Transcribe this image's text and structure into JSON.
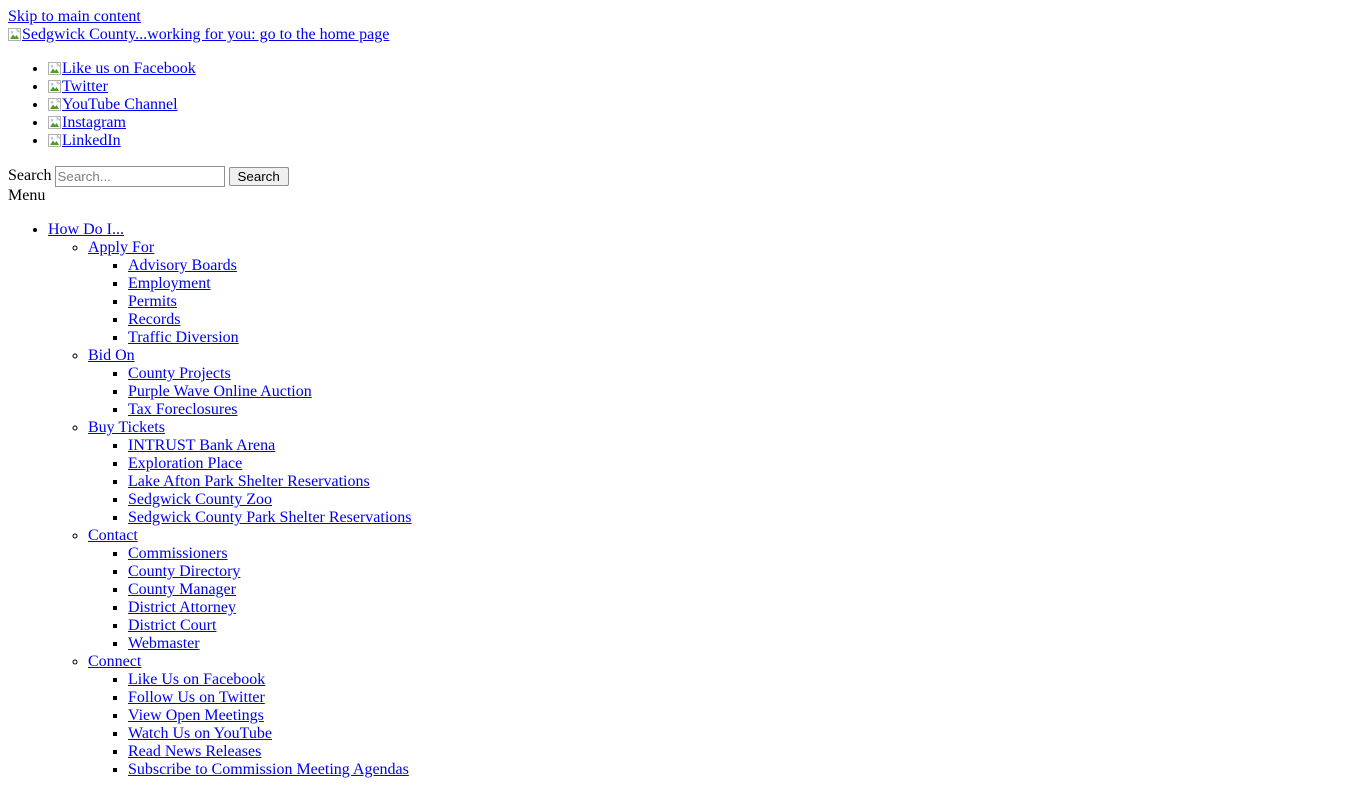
{
  "page": {
    "skip_link": "Skip to main content",
    "logo_link": "Sedgwick County...working for you: go to the home page",
    "menu_label": "Menu"
  },
  "social": {
    "items": [
      {
        "label": "Like us on Facebook",
        "icon": "broken-image-icon"
      },
      {
        "label": "Twitter",
        "icon": "broken-image-icon"
      },
      {
        "label": "YouTube Channel",
        "icon": "broken-image-icon"
      },
      {
        "label": "Instagram",
        "icon": "broken-image-icon"
      },
      {
        "label": "LinkedIn",
        "icon": "broken-image-icon"
      }
    ]
  },
  "search": {
    "label": "Search",
    "placeholder": "Search...",
    "value": "",
    "button_label": "Search"
  },
  "menu": {
    "items": [
      {
        "label": "How Do I...",
        "groups": [
          {
            "label": "Apply For",
            "links": [
              "Advisory Boards",
              "Employment",
              "Permits",
              "Records",
              "Traffic Diversion"
            ]
          },
          {
            "label": "Bid On",
            "links": [
              "County Projects",
              "Purple Wave Online Auction",
              "Tax Foreclosures"
            ]
          },
          {
            "label": "Buy Tickets",
            "links": [
              "INTRUST Bank Arena",
              "Exploration Place",
              "Lake Afton Park Shelter Reservations",
              "Sedgwick County Zoo",
              "Sedgwick County Park Shelter Reservations"
            ]
          },
          {
            "label": "Contact",
            "links": [
              "Commissioners",
              "County Directory",
              "County Manager",
              "District Attorney",
              "District Court",
              "Webmaster"
            ]
          },
          {
            "label": "Connect",
            "links": [
              "Like Us on Facebook",
              "Follow Us on Twitter",
              "View Open Meetings",
              "Watch Us on YouTube",
              "Read News Releases",
              "Subscribe to Commission Meeting Agendas"
            ]
          }
        ]
      }
    ]
  },
  "colors": {
    "link": "#0000EE",
    "text": "#000000",
    "background": "#FFFFFF",
    "input_border": "#8F8F9D",
    "button_background": "#EFEFEF",
    "placeholder": "#808080"
  }
}
